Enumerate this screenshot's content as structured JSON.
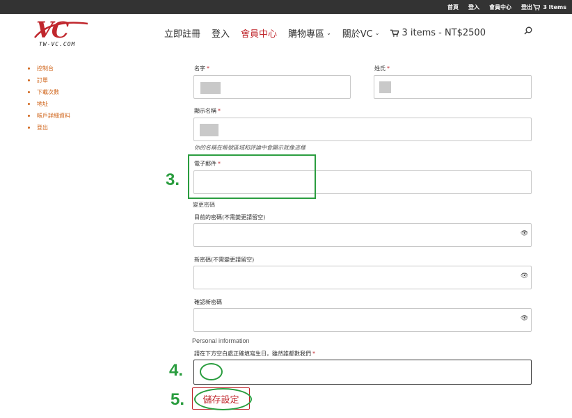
{
  "topbar": {
    "links": [
      "首頁",
      "登入",
      "會員中心",
      "登出"
    ],
    "cart_label": "3 Items"
  },
  "header": {
    "logo_text": "VC",
    "logo_subtext": "TW-VC.COM",
    "nav": {
      "register": "立即註冊",
      "login": "登入",
      "member_center": "會員中心",
      "shop": "購物專區",
      "about": "關於VC",
      "cart": "3 items - NT$2500"
    }
  },
  "sidebar": {
    "items": [
      "控制台",
      "訂單",
      "下載次數",
      "地址",
      "帳戶詳細資料",
      "登出"
    ]
  },
  "form": {
    "first_name_label": "名字",
    "last_name_label": "姓氏",
    "display_name_label": "顯示名稱",
    "display_name_help": "你的名稱在帳號區域和評論中會顯示就像這樣",
    "email_label": "電子郵件",
    "password_section": "變更密碼",
    "current_password_label": "目前的密碼(不需變更請留空)",
    "new_password_label": "新密碼(不需變更請留空)",
    "confirm_password_label": "確認新密碼",
    "personal_info_section": "Personal information",
    "birthday_label": "請在下方空白處正確填寫生日，雖然誰都數我們",
    "required_mark": "*",
    "save_button": "儲存設定"
  },
  "annotations": {
    "step3": "3.",
    "step4": "4.",
    "step5": "5.",
    "color": "#2a9d3f"
  }
}
